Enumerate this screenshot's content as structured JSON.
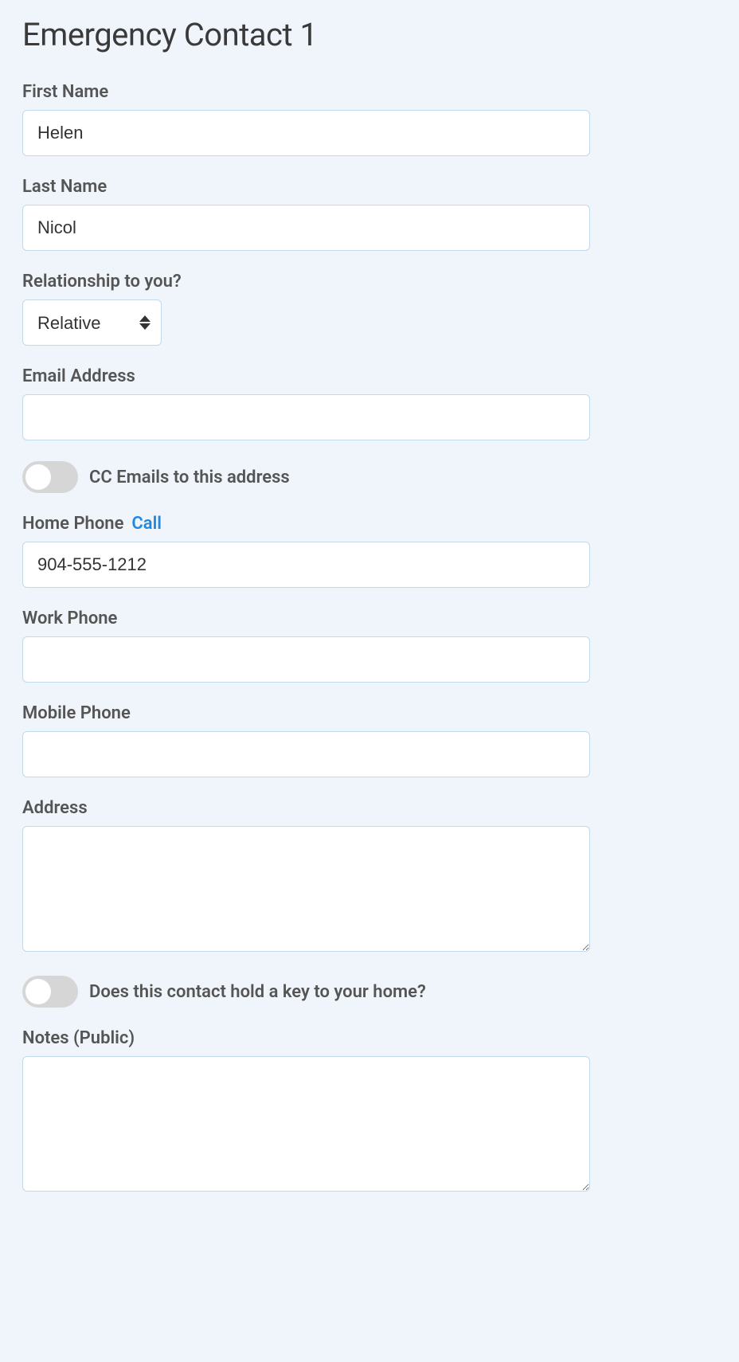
{
  "title": "Emergency Contact 1",
  "fields": {
    "first_name": {
      "label": "First Name",
      "value": "Helen"
    },
    "last_name": {
      "label": "Last Name",
      "value": "Nicol"
    },
    "relationship": {
      "label": "Relationship to you?",
      "value": "Relative"
    },
    "email": {
      "label": "Email Address",
      "value": ""
    },
    "cc_toggle": {
      "label": "CC Emails to this address",
      "on": false
    },
    "home_phone": {
      "label": "Home Phone",
      "call_link": "Call",
      "value": "904-555-1212"
    },
    "work_phone": {
      "label": "Work Phone",
      "value": ""
    },
    "mobile_phone": {
      "label": "Mobile Phone",
      "value": ""
    },
    "address": {
      "label": "Address",
      "value": ""
    },
    "key_toggle": {
      "label": "Does this contact hold a key to your home?",
      "on": false
    },
    "notes": {
      "label": "Notes (Public)",
      "value": ""
    }
  }
}
